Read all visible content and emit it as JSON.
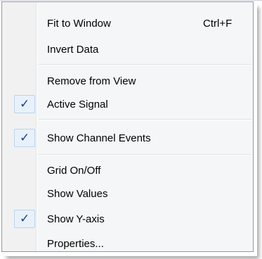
{
  "menu": {
    "items": [
      {
        "label": "Fit to Window",
        "shortcut": "Ctrl+F",
        "checked": false
      },
      {
        "label": "Invert Data",
        "shortcut": "",
        "checked": false
      },
      {
        "label": "Remove from View",
        "shortcut": "",
        "checked": false
      },
      {
        "label": "Active Signal",
        "shortcut": "",
        "checked": true
      },
      {
        "label": "Show Channel Events",
        "shortcut": "",
        "checked": true
      },
      {
        "label": "Grid On/Off",
        "shortcut": "",
        "checked": false
      },
      {
        "label": "Show Values",
        "shortcut": "",
        "checked": false
      },
      {
        "label": "Show Y-axis",
        "shortcut": "",
        "checked": true
      },
      {
        "label": "Properties...",
        "shortcut": "",
        "checked": false
      }
    ],
    "check_glyph": "✓",
    "colors": {
      "background": "#f5f6f7",
      "border": "#979797",
      "check_color": "#1b3f8c",
      "check_box_fill": "#e8f1fb",
      "check_box_border": "#b9d4ee"
    }
  }
}
